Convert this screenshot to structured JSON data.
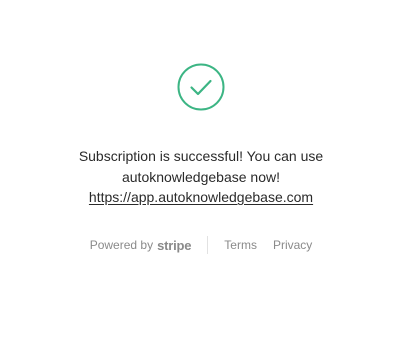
{
  "status": {
    "icon": "check-circle-icon",
    "color": "#3cb584"
  },
  "message": {
    "line1": "Subscription is successful! You can use",
    "line2": "autoknowledgebase now!",
    "link": "https://app.autoknowledgebase.com"
  },
  "footer": {
    "powered_by": "Powered by",
    "brand": "stripe",
    "terms": "Terms",
    "privacy": "Privacy"
  }
}
